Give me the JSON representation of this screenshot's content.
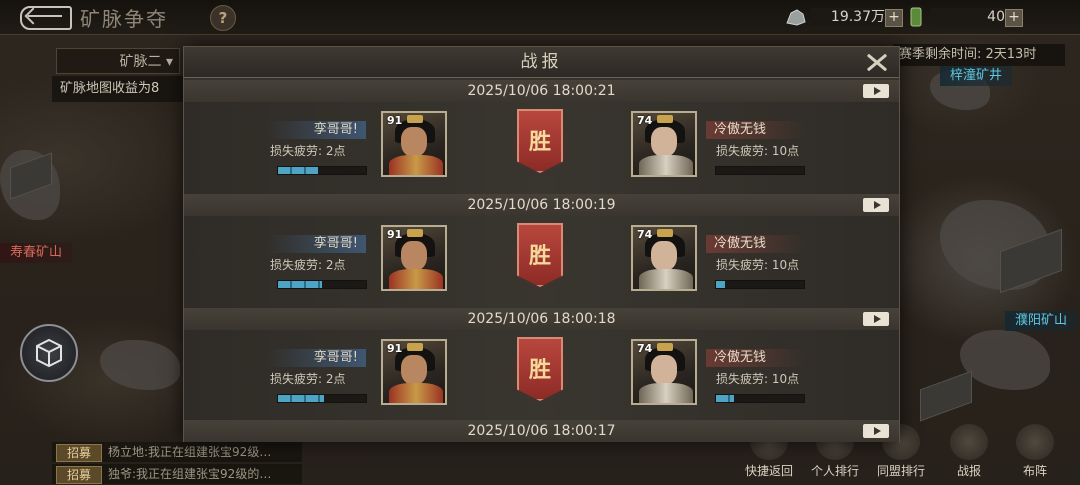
{
  "topbar": {
    "title": "矿脉争夺",
    "help": "?",
    "resource_1": "19.37万",
    "resource_2": "40",
    "plus": "+"
  },
  "left_panel": {
    "mine_select": "矿脉二 ▾",
    "mine_info": "矿脉地图收益为8"
  },
  "map": {
    "countdown": "赛季剩余时间: 2天13时",
    "label_top_right": "梓潼矿井",
    "label_left": "寿春矿山",
    "label_right": "濮阳矿山"
  },
  "chat": [
    {
      "tag": "招募",
      "msg": "杨立地:我正在组建张宝92级…"
    },
    {
      "tag": "招募",
      "msg": "独爷:我正在组建张宝92级的…"
    }
  ],
  "nav": [
    {
      "label": "快捷返回",
      "icon": "return-icon"
    },
    {
      "label": "个人排行",
      "icon": "ranking-icon"
    },
    {
      "label": "同盟排行",
      "icon": "alliance-ranking-icon"
    },
    {
      "label": "战报",
      "icon": "battle-report-icon"
    },
    {
      "label": "布阵",
      "icon": "formation-icon"
    }
  ],
  "modal": {
    "title": "战报",
    "close": "close-icon"
  },
  "reports": [
    {
      "date": "2025/10/06 18:00:21",
      "attacker": {
        "name": "孪哥哥!",
        "level": "91",
        "loss": "损失疲劳: 2点",
        "bar": 0.45
      },
      "result": "胜",
      "defender": {
        "name": "冷傲无钱",
        "level": "74",
        "loss": "损失疲劳: 10点",
        "bar": 0.0
      }
    },
    {
      "date": "2025/10/06 18:00:19",
      "attacker": {
        "name": "孪哥哥!",
        "level": "91",
        "loss": "损失疲劳: 2点",
        "bar": 0.5
      },
      "result": "胜",
      "defender": {
        "name": "冷傲无钱",
        "level": "74",
        "loss": "损失疲劳: 10点",
        "bar": 0.1
      }
    },
    {
      "date": "2025/10/06 18:00:18",
      "attacker": {
        "name": "孪哥哥!",
        "level": "91",
        "loss": "损失疲劳: 2点",
        "bar": 0.52
      },
      "result": "胜",
      "defender": {
        "name": "冷傲无钱",
        "level": "74",
        "loss": "损失疲劳: 10点",
        "bar": 0.2
      }
    },
    {
      "date": "2025/10/06 18:00:17"
    }
  ],
  "colors": {
    "accent_blue": "#4ea4c4",
    "victory_red": "#b8473e",
    "victory_text": "#f6d89a"
  }
}
